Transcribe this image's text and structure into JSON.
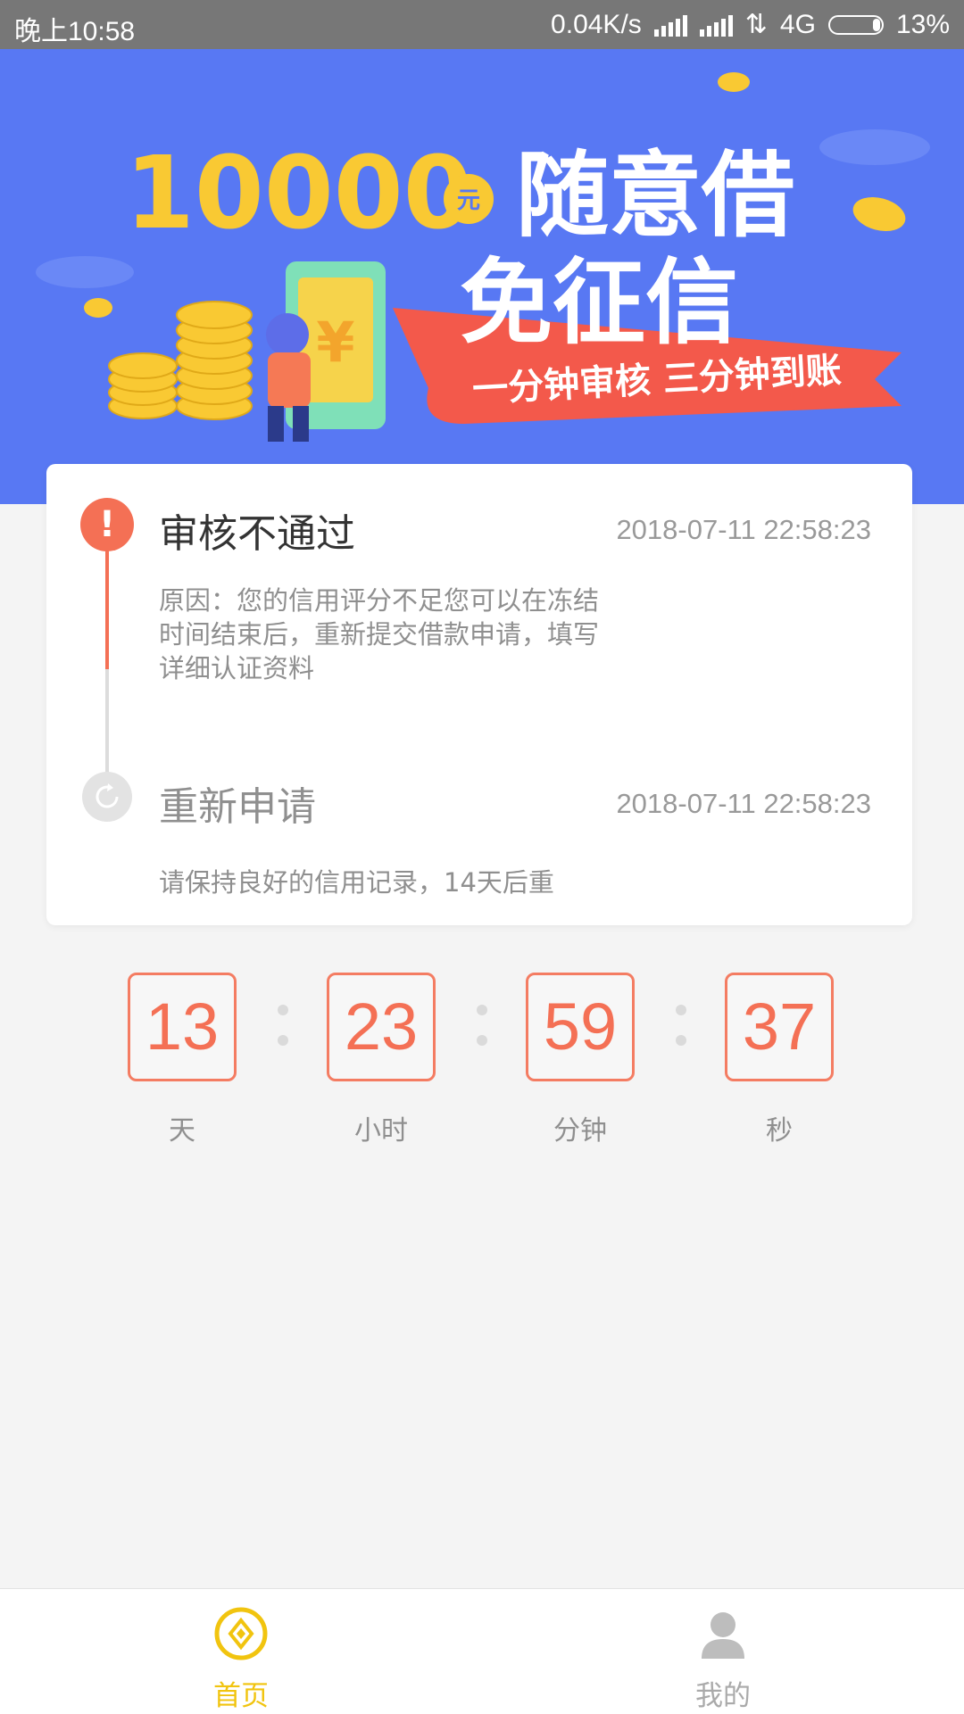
{
  "status_bar": {
    "time": "晚上10:58",
    "net_speed": "0.04K/s",
    "network": "4G",
    "battery": "13%"
  },
  "banner": {
    "amount": "10000",
    "unit": "元",
    "headline_1": "随意借",
    "headline_2": "免征信",
    "ribbon": "一分钟审核 三分钟到账",
    "currency_symbol": "¥"
  },
  "timeline": {
    "step1": {
      "title": "审核不通过",
      "time": "2018-07-11 22:58:23",
      "reason": "原因：您的信用评分不足您可以在冻结时间结束后，重新提交借款申请，填写详细认证资料"
    },
    "step2": {
      "title": "重新申请",
      "time": "2018-07-11 22:58:23",
      "hint": "请保持良好的信用记录，14天后重"
    }
  },
  "countdown": {
    "days": "13",
    "hours": "23",
    "minutes": "59",
    "seconds": "37",
    "days_label": "天",
    "hours_label": "小时",
    "minutes_label": "分钟",
    "seconds_label": "秒"
  },
  "tabbar": {
    "home": "首页",
    "mine": "我的"
  },
  "colors": {
    "banner_blue": "#5878f3",
    "accent_orange": "#f47055",
    "gold": "#f9c933",
    "active_tab": "#f1c40f"
  }
}
